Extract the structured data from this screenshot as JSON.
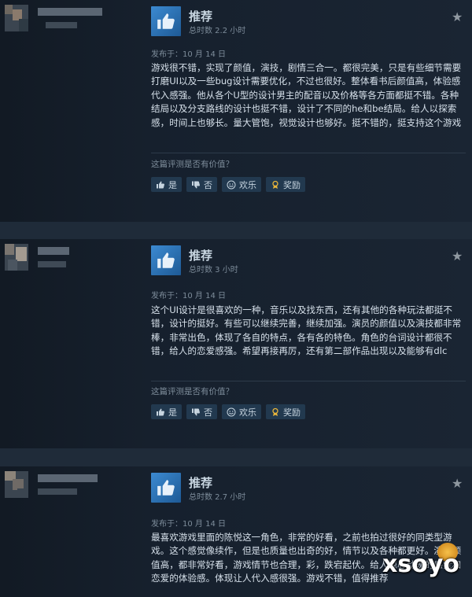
{
  "reviews": [
    {
      "recommendation": "推荐",
      "hours": "总时数 2.2 小时",
      "posted": "发布于：10 月 14 日",
      "body": "游戏很不错，实现了颜值，演技，剧情三合一。都很完美，只是有些细节需要打磨UI以及一些bug设计需要优化，不过也很好。整体看书后颜值高，体验感代入感强。他从各个U型的设计男主的配音以及价格等各方面都挺不错。各种结局以及分支路线的设计也挺不错，设计了不同的he和be结局。给人以探索感，时间上也够长。量大管饱，视觉设计也够好。挺不错的，挺支持这个游戏",
      "helpful_prompt": "这篇评测是否有价值？",
      "buttons": {
        "yes": "是",
        "no": "否",
        "funny": "欢乐",
        "award": "奖励"
      }
    },
    {
      "recommendation": "推荐",
      "hours": "总时数 3 小时",
      "posted": "发布于：10 月 14 日",
      "body": "这个UI设计是很喜欢的一种，音乐以及找东西，还有其他的各种玩法都挺不错，设计的挺好。有些可以继续完善，继续加强。演员的颜值以及演技都非常棒，非常出色，体现了各自的特点，各有各的特色。角色的台词设计都很不错，给人的恋爱感强。希望再接再厉，还有第二部作品出现以及能够有dlc",
      "helpful_prompt": "这篇评测是否有价值？",
      "buttons": {
        "yes": "是",
        "no": "否",
        "funny": "欢乐",
        "award": "奖励"
      }
    },
    {
      "recommendation": "推荐",
      "hours": "总时数 2.7 小时",
      "posted": "发布于：10 月 14 日",
      "body": "最喜欢游戏里面的陈悦这一角色，非常的好看，之前也拍过很好的同类型游戏。这个感觉像续作，但是也质量也出奇的好，情节以及各种都更好。演员颜值高，都非常好看，游戏情节也合理，彩，跌宕起伏。给人惊心动魄的感觉和恋爱的体验感。体现让人代入感很强。游戏不错，值得推荐"
    }
  ],
  "watermark": "xsoyo",
  "colors": {
    "accent": "#3c8ad1",
    "background": "#1b2838",
    "award": "#e8b53b"
  }
}
